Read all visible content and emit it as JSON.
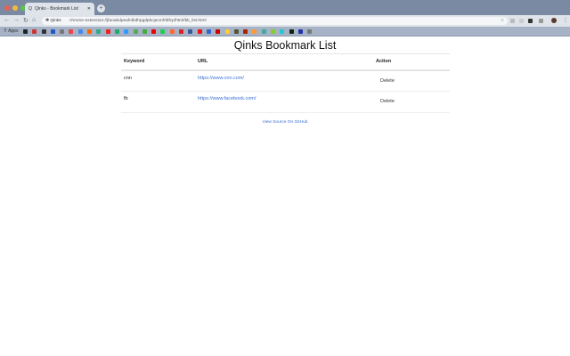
{
  "browser": {
    "tab_title": "Qinks - Bookmark List",
    "tab_favicon": "Q",
    "omnibox_site": "Qinks",
    "url": "chrome-extension://jfaoabdpeafolbdhpgdpbcjacmhfdfcp/html/bk_list.html",
    "apps_label": "Apps",
    "bookmark_colors": [
      "#222",
      "#c33",
      "#333",
      "#2255cc",
      "#777",
      "#e44",
      "#4488ee",
      "#f60",
      "#3a8",
      "#e22",
      "#2a6",
      "#39f",
      "#5a5",
      "#4a4",
      "#e00",
      "#2c5",
      "#f63",
      "#d22",
      "#3b5998",
      "#e11",
      "#3366cc",
      "#c00",
      "#fc3",
      "#553",
      "#a20",
      "#f93",
      "#4a9",
      "#8c3",
      "#2cc",
      "#121",
      "#23a",
      "#777"
    ],
    "ext_colors": [
      "#bbb",
      "#ccc",
      "#333",
      "#999"
    ]
  },
  "page": {
    "title": "Qinks Bookmark List",
    "headers": {
      "keyword": "Keyword",
      "url": "URL",
      "action": "Action"
    },
    "rows": [
      {
        "keyword": "cnn",
        "url": "https://www.cnn.com/",
        "action": "Delete"
      },
      {
        "keyword": "fb",
        "url": "https://www.facebook.com/",
        "action": "Delete"
      }
    ],
    "github_link": "View Source On GitHub"
  }
}
